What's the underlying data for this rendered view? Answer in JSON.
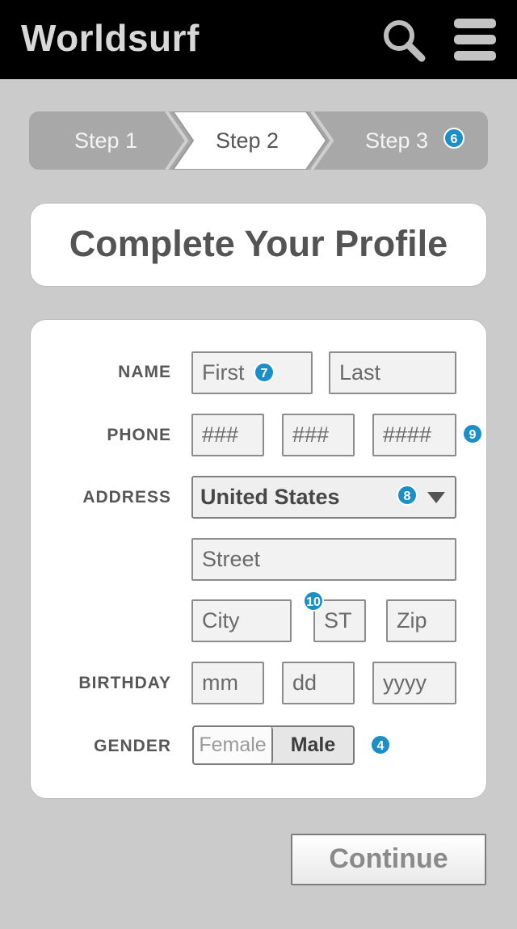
{
  "header": {
    "app_title": "Worldsurf",
    "search_icon": "search-icon",
    "menu_icon": "hamburger-menu-icon"
  },
  "stepper": {
    "steps": [
      {
        "label": "Step 1",
        "state": "completed"
      },
      {
        "label": "Step 2",
        "state": "active"
      },
      {
        "label": "Step 3",
        "state": "upcoming"
      }
    ]
  },
  "page_title": "Complete Your Profile",
  "form": {
    "name_label": "NAME",
    "first_placeholder": "First",
    "last_placeholder": "Last",
    "phone_label": "PHONE",
    "phone_area_placeholder": "###",
    "phone_prefix_placeholder": "###",
    "phone_line_placeholder": "####",
    "address_label": "ADDRESS",
    "country_value": "United States",
    "street_placeholder": "Street",
    "city_placeholder": "City",
    "state_placeholder": "ST",
    "zip_placeholder": "Zip",
    "birthday_label": "BIRTHDAY",
    "month_placeholder": "mm",
    "day_placeholder": "dd",
    "year_placeholder": "yyyy",
    "gender_label": "GENDER",
    "gender_options": [
      "Female",
      "Male"
    ],
    "gender_selected": "Male"
  },
  "annotations": {
    "step3": "6",
    "first_name": "7",
    "country": "8",
    "phone": "9",
    "state": "10",
    "gender": "4"
  },
  "continue_label": "Continue",
  "colors": {
    "header_bg": "#000000",
    "page_bg": "#cbcbcb",
    "badge": "#1a8fc8"
  }
}
